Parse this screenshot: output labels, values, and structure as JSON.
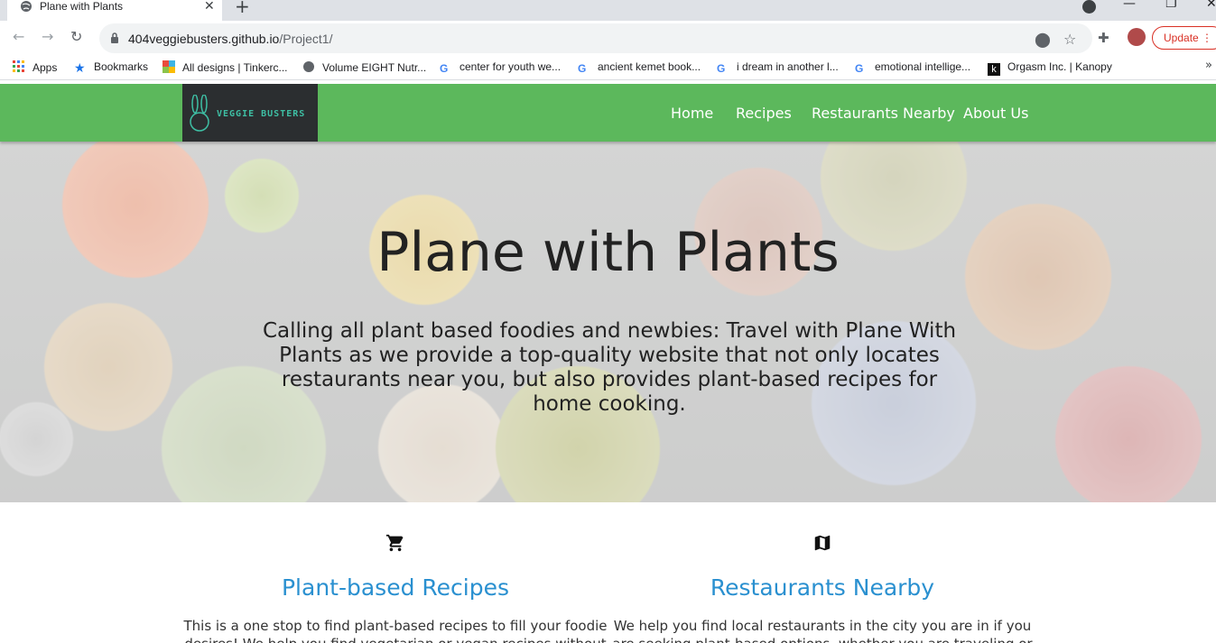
{
  "browser": {
    "tab_title": "Plane with Plants",
    "url_domain": "404veggiebusters.github.io",
    "url_path": "/Project1/",
    "update_label": "Update",
    "bookmarks": [
      {
        "label": "Apps",
        "icon": "apps-grid-icon"
      },
      {
        "label": "Bookmarks",
        "icon": "star-icon"
      },
      {
        "label": "All designs | Tinkerc...",
        "icon": "tinkercad-icon"
      },
      {
        "label": "Volume EIGHT Nutr...",
        "icon": "globe-icon"
      },
      {
        "label": "center for youth we...",
        "icon": "google-icon"
      },
      {
        "label": "ancient kemet book...",
        "icon": "google-icon"
      },
      {
        "label": "i dream in another l...",
        "icon": "google-icon"
      },
      {
        "label": "emotional intellige...",
        "icon": "google-icon"
      },
      {
        "label": "Orgasm Inc. | Kanopy",
        "icon": "kanopy-icon"
      }
    ]
  },
  "site": {
    "logo_text": "VEGGIE BUSTERS",
    "nav": {
      "home": "Home",
      "recipes": "Recipes",
      "restaurants": "Restaurants Nearby",
      "about": "About Us"
    },
    "hero": {
      "title": "Plane with Plants",
      "text": "Calling all plant based foodies and newbies: Travel with Plane With Plants as we provide a top-quality website that not only locates restaurants near you, but also provides plant-based recipes for home cooking."
    },
    "features": [
      {
        "icon": "shopping-cart-icon",
        "title": "Plant-based Recipes",
        "text": "This is a one stop to find plant-based recipes to fill your foodie desires! We help you find vegetarian or vegan recipes without"
      },
      {
        "icon": "map-icon",
        "title": "Restaurants Nearby",
        "text": "We help you find local restaurants in the city you are in if you are seeking plant-based options, whether you are traveling or"
      }
    ]
  }
}
